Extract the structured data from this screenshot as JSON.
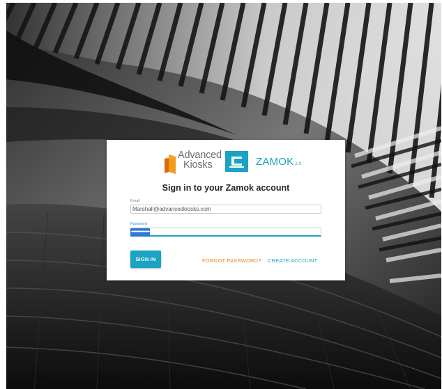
{
  "login": {
    "brand_advanced_line1": "Advanced",
    "brand_advanced_line2": "Kiosks",
    "brand_zamok": "ZAMOK",
    "brand_zamok_version": "2.0",
    "title": "Sign in to your Zamok account",
    "email_label": "Email",
    "email_value": "Marshall@advancedkiosks.com",
    "password_label": "Password",
    "password_value": "••••••••••••••••••",
    "sign_in_label": "SIGN IN",
    "forgot_password_label": "FORGOT PASSWORD?",
    "create_account_label": "CREATE ACCOUNT"
  },
  "colors": {
    "accent": "#1aa3c2",
    "link_orange": "#e8821e",
    "selection": "#2f7ad6"
  },
  "icons": {
    "advanced_kiosks_logo": "advanced-kiosks-logo",
    "zamok_logo": "zamok-logo"
  }
}
